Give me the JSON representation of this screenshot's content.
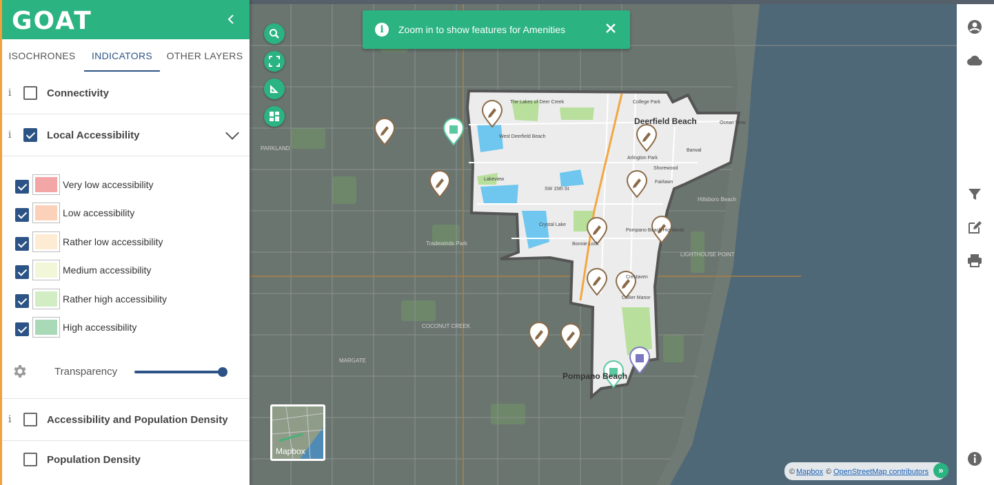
{
  "app": {
    "logo": "GOAT",
    "brand_color": "#2bb381"
  },
  "tabs": [
    {
      "label": "ISOCHRONES",
      "active": false
    },
    {
      "label": "INDICATORS",
      "active": true
    },
    {
      "label": "OTHER LAYERS",
      "active": false
    }
  ],
  "layers": {
    "connectivity": {
      "label": "Connectivity",
      "checked": false,
      "info": "i"
    },
    "local_accessibility": {
      "label": "Local Accessibility",
      "checked": true,
      "expanded": true,
      "info": "i"
    },
    "access_pop_density": {
      "label": "Accessibility and Population Density",
      "checked": false,
      "info": "i"
    },
    "pop_density": {
      "label": "Population Density",
      "checked": false
    }
  },
  "legend": [
    {
      "label": "Very low accessibility",
      "checked": true,
      "color": "#f2a6a6"
    },
    {
      "label": "Low accessibility",
      "checked": true,
      "color": "#fcd1b9"
    },
    {
      "label": "Rather low accessibility",
      "checked": true,
      "color": "#fdebd3"
    },
    {
      "label": "Medium accessibility",
      "checked": true,
      "color": "#f1f7d8"
    },
    {
      "label": "Rather high accessibility",
      "checked": true,
      "color": "#d2ecc4"
    },
    {
      "label": "High accessibility",
      "checked": true,
      "color": "#a9d9b6"
    }
  ],
  "transparency": {
    "label": "Transparency",
    "value": 1.0
  },
  "toast": {
    "message": "Zoom in to show features for Amenities"
  },
  "basemap": {
    "label": "Mapbox"
  },
  "attribution": {
    "copy1": "©",
    "mapbox": "Mapbox",
    "copy2": "©",
    "osm": "OpenStreetMap contributors",
    "expand": "»"
  },
  "map_labels": {
    "deerfield": "Deerfield Beach",
    "pompano": "Pompano Beach",
    "lakeview": "Lakeview",
    "crystal_lake": "Crystal Lake",
    "arlington": "Arlington Park",
    "college_park": "College Park",
    "barwal": "Barwal",
    "shorewood": "Shorewood",
    "fairlawn": "Fairlawn",
    "bonnie_lock": "Bonnie Lock",
    "parkland": "PARKLAND",
    "margate": "MARGATE",
    "coconut_creek": "COCONUT CREEK",
    "hillsboro": "Hillsboro Beach",
    "tradewinds": "Tradewinds Park",
    "west_deerfield": "West Deerfield Beach",
    "lakes_deer_creek": "The Lakes of Deer Creek",
    "sw15": "SW 15th St",
    "pompano_highlands": "Pompano Beach Highlands",
    "crestaven": "Crestaven",
    "collier_manor": "Collier Manor",
    "ocean_view": "Ocean View",
    "lighthouse_point": "LIGHTHOUSE POINT"
  },
  "colors": {
    "study_area_fill": "#ececec",
    "study_area_border": "#555555",
    "poi_pencil": "#8a6a48",
    "poi_school": "#7b77c2",
    "poi_health": "#5ac8a0"
  }
}
